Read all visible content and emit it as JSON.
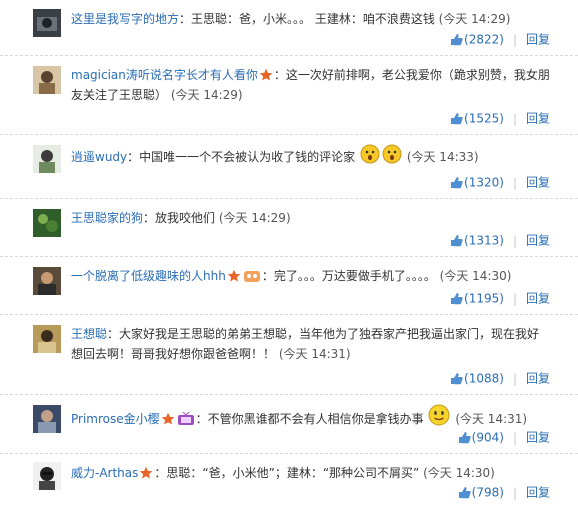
{
  "comments": [
    {
      "user": "这里是我写字的地方",
      "text": "：王思聪：爸，小米。。。  王建林：咱不浪费这钱",
      "time": "(今天 14:29)",
      "likes": "(2822)",
      "reply": "回复"
    },
    {
      "user": "magician涛听说名字长才有人看你",
      "text": "：这一次好前排啊，老公我爱你（跪求别赞，我女朋友关注了王思聪）",
      "time": "(今天 14:29)",
      "likes": "(1525)",
      "reply": "回复"
    },
    {
      "user": "逍遥wudy",
      "text": "：中国唯一一个不会被认为收了钱的评论家",
      "time": "(今天 14:33)",
      "likes": "(1320)",
      "reply": "回复"
    },
    {
      "user": "王思聪家的狗",
      "text": "：放我咬他们",
      "time": "(今天 14:29)",
      "likes": "(1313)",
      "reply": "回复"
    },
    {
      "user": "一个脱离了低级趣味的人hhh",
      "text": "：完了。。。万达要做手机了。。。。",
      "time": "(今天 14:30)",
      "likes": "(1195)",
      "reply": "回复"
    },
    {
      "user": "王想聪",
      "text": "：大家好我是王思聪的弟弟王想聪，当年他为了独吞家产把我逼出家门，现在我好想回去啊！哥哥我好想你跟爸爸啊！！",
      "time": "(今天 14:31)",
      "likes": "(1088)",
      "reply": "回复"
    },
    {
      "user": "Primrose金小樱",
      "text": "：不管你黑谁都不会有人相信你是拿钱办事",
      "time": "(今天 14:31)",
      "likes": "(904)",
      "reply": "回复"
    },
    {
      "user": "威力-Arthas",
      "text": "：思聪：“爸，小米他”；建林：“那种公司不屑买”",
      "time": "(今天 14:30)",
      "likes": "(798)",
      "reply": "回复"
    }
  ]
}
